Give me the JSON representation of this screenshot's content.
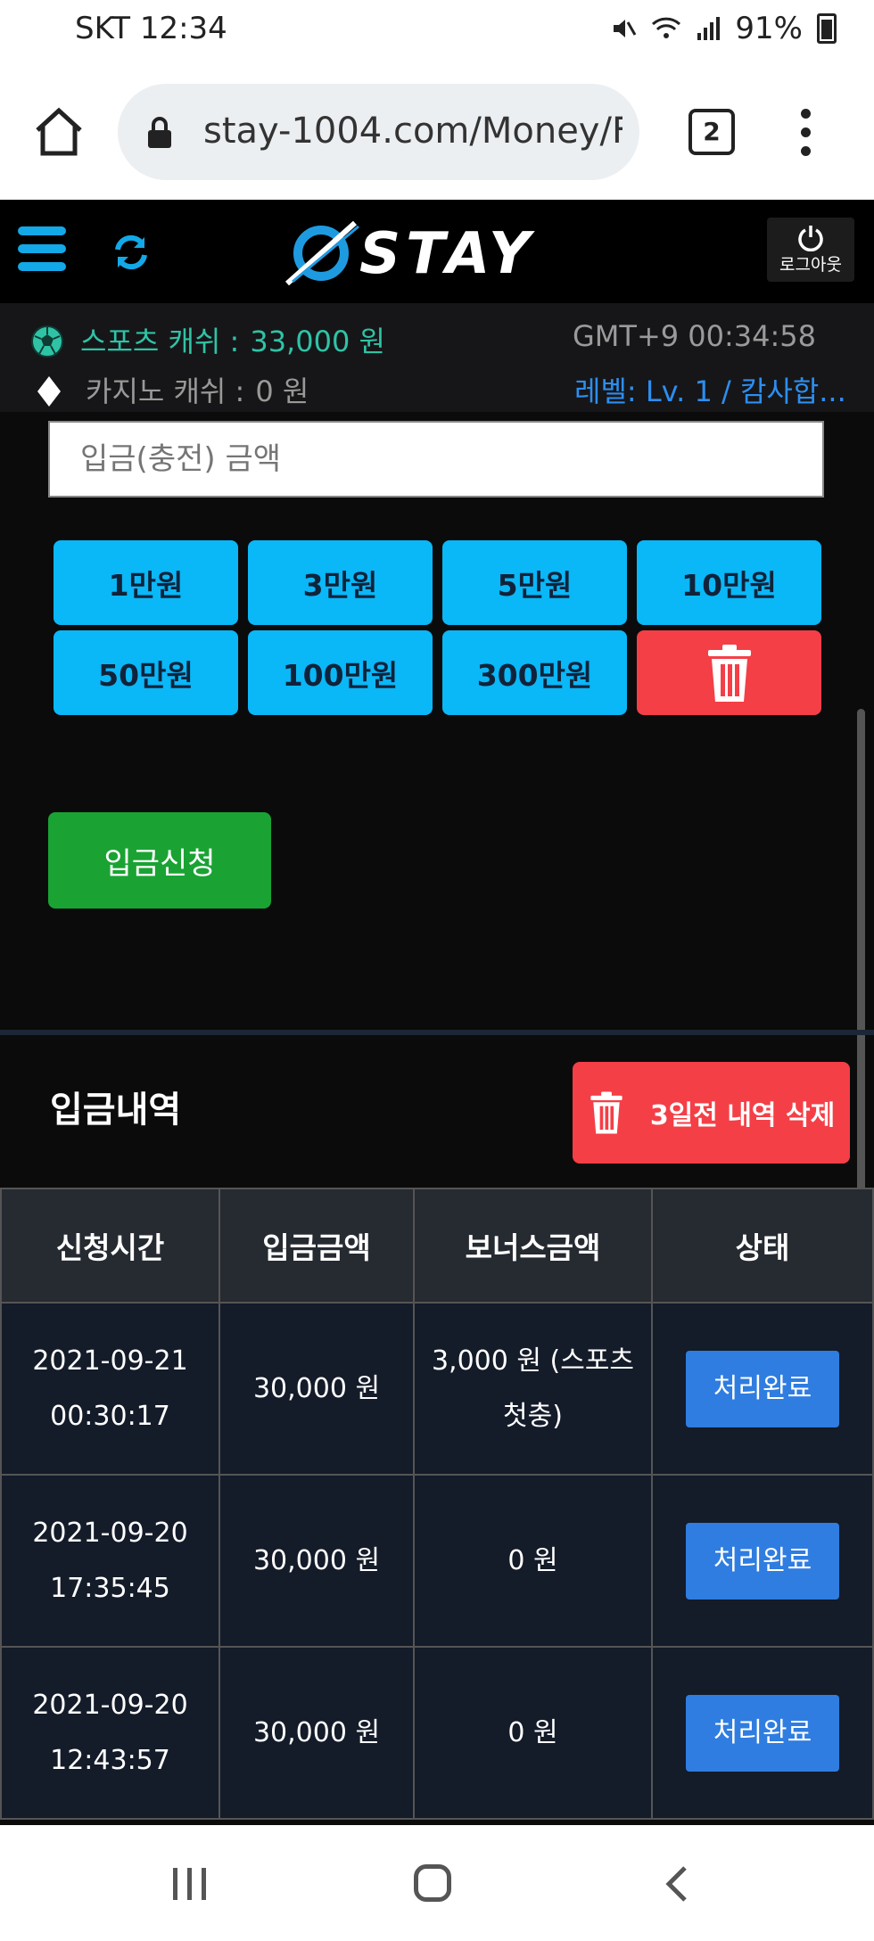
{
  "status_bar": {
    "carrier_time": "SKT  12:34",
    "battery": "91%"
  },
  "browser": {
    "url": "stay-1004.com/Money/F",
    "tab_count": "2"
  },
  "header": {
    "logo": "STAY",
    "logout_label": "로그아웃"
  },
  "info": {
    "sports_label": "스포츠 캐쉬 :",
    "sports_value": "33,000 원",
    "casino_label": "카지노 캐쉬 :",
    "casino_value": "0 원",
    "time": "GMT+9 00:34:58",
    "level": "레벨: Lv. 1 / 캄사합..."
  },
  "deposit": {
    "amount_placeholder": "입금(충전) 금액",
    "amount_buttons": [
      "1만원",
      "3만원",
      "5만원",
      "10만원",
      "50만원",
      "100만원",
      "300만원"
    ],
    "submit_label": "입금신청"
  },
  "history": {
    "title": "입금내역",
    "delete_label": "3일전 내역 삭제",
    "columns": [
      "신청시간",
      "입금금액",
      "보너스금액",
      "상태"
    ],
    "rows": [
      {
        "date": "2021-09-21",
        "time": "00:30:17",
        "amount": "30,000 원",
        "bonus_line1": "3,000 원 (스포츠",
        "bonus_line2": "첫충)",
        "status": "처리완료"
      },
      {
        "date": "2021-09-20",
        "time": "17:35:45",
        "amount": "30,000 원",
        "bonus_line1": "0 원",
        "bonus_line2": "",
        "status": "처리완료"
      },
      {
        "date": "2021-09-20",
        "time": "12:43:57",
        "amount": "30,000 원",
        "bonus_line1": "0 원",
        "bonus_line2": "",
        "status": "처리완료"
      }
    ]
  },
  "colors": {
    "accent_blue": "#0ab7f7",
    "danger_red": "#f43f47",
    "success_green": "#1aa333",
    "status_blue": "#2f7de0"
  }
}
